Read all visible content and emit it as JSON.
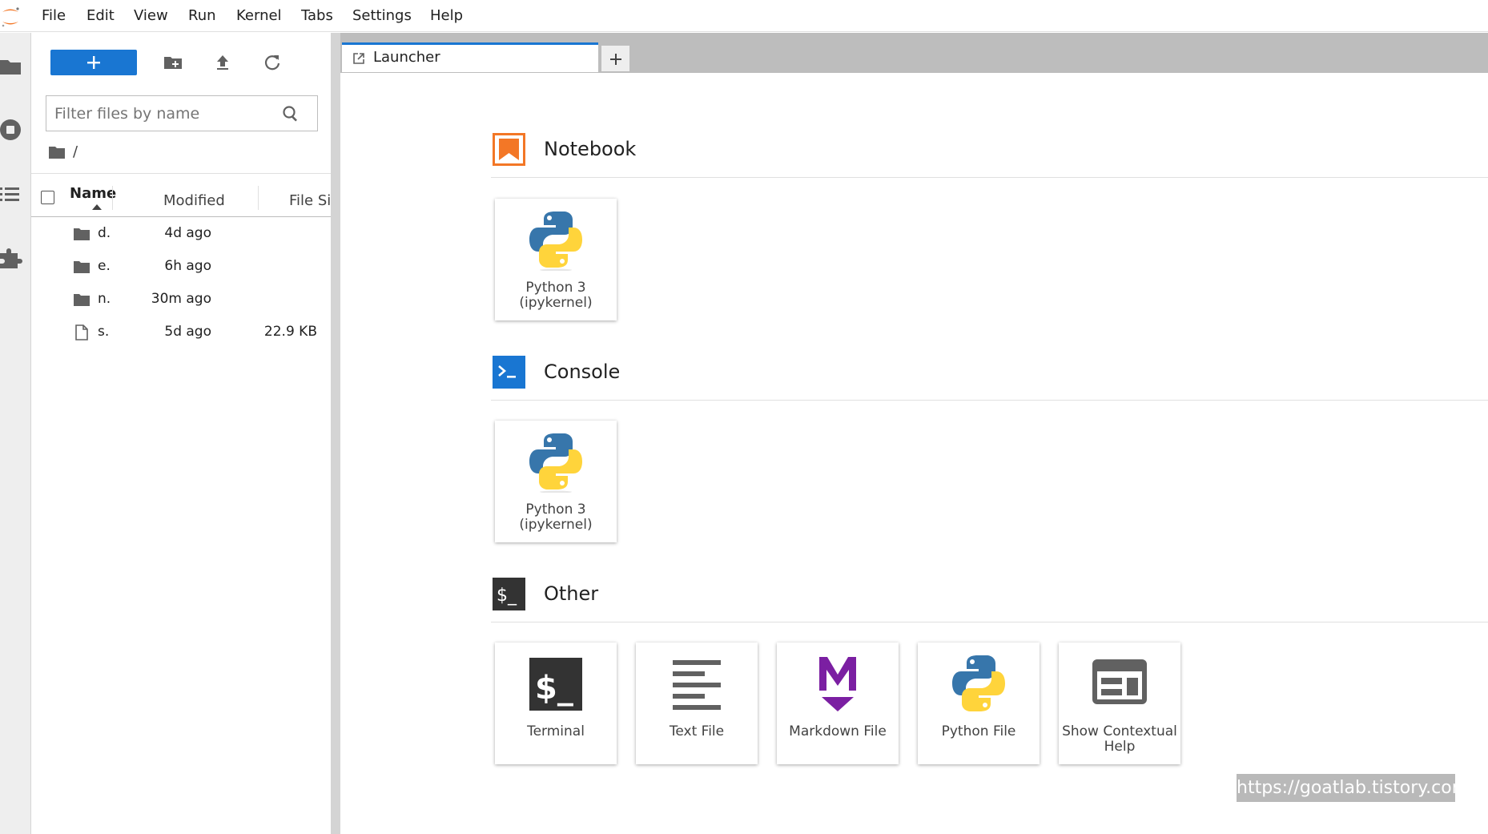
{
  "menubar": {
    "items": [
      "File",
      "Edit",
      "View",
      "Run",
      "Kernel",
      "Tabs",
      "Settings",
      "Help"
    ]
  },
  "filebrowser": {
    "new_launcher_label": "+",
    "filter_placeholder": "Filter files by name",
    "breadcrumb": "/",
    "columns": {
      "name": "Name",
      "modified": "Modified",
      "file_size": "File Size"
    },
    "sort": {
      "column": "Name",
      "direction": "ascending"
    },
    "files": [
      {
        "name": "d.",
        "type": "folder",
        "modified": "4d ago",
        "size": ""
      },
      {
        "name": "e.",
        "type": "folder",
        "modified": "6h ago",
        "size": ""
      },
      {
        "name": "n.",
        "type": "folder",
        "modified": "30m ago",
        "size": ""
      },
      {
        "name": "s.",
        "type": "file",
        "modified": "5d ago",
        "size": "22.9 KB"
      }
    ]
  },
  "tabs": {
    "items": [
      {
        "label": "Launcher",
        "active": true
      }
    ],
    "add_label": "+"
  },
  "launcher": {
    "sections": [
      {
        "title": "Notebook",
        "icon": "notebook-icon",
        "cards": [
          {
            "label": "Python 3 (ipykernel)",
            "icon": "python-logo-icon"
          }
        ]
      },
      {
        "title": "Console",
        "icon": "console-icon",
        "cards": [
          {
            "label": "Python 3 (ipykernel)",
            "icon": "python-logo-icon"
          }
        ]
      },
      {
        "title": "Other",
        "icon": "other-terminal-icon",
        "cards": [
          {
            "label": "Terminal",
            "icon": "terminal-icon"
          },
          {
            "label": "Text File",
            "icon": "text-file-icon"
          },
          {
            "label": "Markdown File",
            "icon": "markdown-icon"
          },
          {
            "label": "Python File",
            "icon": "python-logo-icon"
          },
          {
            "label": "Show Contextual Help",
            "icon": "contextual-help-icon"
          }
        ]
      }
    ]
  },
  "watermark": "https://goatlab.tistory.com",
  "colors": {
    "accent_blue": "#1976d2",
    "jupyter_orange": "#f37726",
    "markdown_purple": "#7b1fa2",
    "python_blue": "#3776ab",
    "python_yellow": "#ffd43b"
  }
}
